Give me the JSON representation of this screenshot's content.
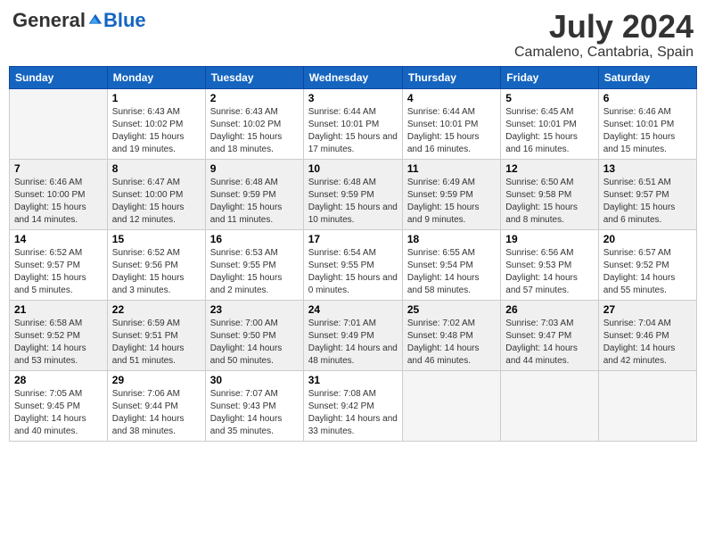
{
  "header": {
    "logo_general": "General",
    "logo_blue": "Blue",
    "month": "July 2024",
    "location": "Camaleno, Cantabria, Spain"
  },
  "weekdays": [
    "Sunday",
    "Monday",
    "Tuesday",
    "Wednesday",
    "Thursday",
    "Friday",
    "Saturday"
  ],
  "weeks": [
    [
      {
        "day": "",
        "empty": true
      },
      {
        "day": "1",
        "sunrise": "Sunrise: 6:43 AM",
        "sunset": "Sunset: 10:02 PM",
        "daylight": "Daylight: 15 hours and 19 minutes."
      },
      {
        "day": "2",
        "sunrise": "Sunrise: 6:43 AM",
        "sunset": "Sunset: 10:02 PM",
        "daylight": "Daylight: 15 hours and 18 minutes."
      },
      {
        "day": "3",
        "sunrise": "Sunrise: 6:44 AM",
        "sunset": "Sunset: 10:01 PM",
        "daylight": "Daylight: 15 hours and 17 minutes."
      },
      {
        "day": "4",
        "sunrise": "Sunrise: 6:44 AM",
        "sunset": "Sunset: 10:01 PM",
        "daylight": "Daylight: 15 hours and 16 minutes."
      },
      {
        "day": "5",
        "sunrise": "Sunrise: 6:45 AM",
        "sunset": "Sunset: 10:01 PM",
        "daylight": "Daylight: 15 hours and 16 minutes."
      },
      {
        "day": "6",
        "sunrise": "Sunrise: 6:46 AM",
        "sunset": "Sunset: 10:01 PM",
        "daylight": "Daylight: 15 hours and 15 minutes."
      }
    ],
    [
      {
        "day": "7",
        "sunrise": "Sunrise: 6:46 AM",
        "sunset": "Sunset: 10:00 PM",
        "daylight": "Daylight: 15 hours and 14 minutes."
      },
      {
        "day": "8",
        "sunrise": "Sunrise: 6:47 AM",
        "sunset": "Sunset: 10:00 PM",
        "daylight": "Daylight: 15 hours and 12 minutes."
      },
      {
        "day": "9",
        "sunrise": "Sunrise: 6:48 AM",
        "sunset": "Sunset: 9:59 PM",
        "daylight": "Daylight: 15 hours and 11 minutes."
      },
      {
        "day": "10",
        "sunrise": "Sunrise: 6:48 AM",
        "sunset": "Sunset: 9:59 PM",
        "daylight": "Daylight: 15 hours and 10 minutes."
      },
      {
        "day": "11",
        "sunrise": "Sunrise: 6:49 AM",
        "sunset": "Sunset: 9:59 PM",
        "daylight": "Daylight: 15 hours and 9 minutes."
      },
      {
        "day": "12",
        "sunrise": "Sunrise: 6:50 AM",
        "sunset": "Sunset: 9:58 PM",
        "daylight": "Daylight: 15 hours and 8 minutes."
      },
      {
        "day": "13",
        "sunrise": "Sunrise: 6:51 AM",
        "sunset": "Sunset: 9:57 PM",
        "daylight": "Daylight: 15 hours and 6 minutes."
      }
    ],
    [
      {
        "day": "14",
        "sunrise": "Sunrise: 6:52 AM",
        "sunset": "Sunset: 9:57 PM",
        "daylight": "Daylight: 15 hours and 5 minutes."
      },
      {
        "day": "15",
        "sunrise": "Sunrise: 6:52 AM",
        "sunset": "Sunset: 9:56 PM",
        "daylight": "Daylight: 15 hours and 3 minutes."
      },
      {
        "day": "16",
        "sunrise": "Sunrise: 6:53 AM",
        "sunset": "Sunset: 9:55 PM",
        "daylight": "Daylight: 15 hours and 2 minutes."
      },
      {
        "day": "17",
        "sunrise": "Sunrise: 6:54 AM",
        "sunset": "Sunset: 9:55 PM",
        "daylight": "Daylight: 15 hours and 0 minutes."
      },
      {
        "day": "18",
        "sunrise": "Sunrise: 6:55 AM",
        "sunset": "Sunset: 9:54 PM",
        "daylight": "Daylight: 14 hours and 58 minutes."
      },
      {
        "day": "19",
        "sunrise": "Sunrise: 6:56 AM",
        "sunset": "Sunset: 9:53 PM",
        "daylight": "Daylight: 14 hours and 57 minutes."
      },
      {
        "day": "20",
        "sunrise": "Sunrise: 6:57 AM",
        "sunset": "Sunset: 9:52 PM",
        "daylight": "Daylight: 14 hours and 55 minutes."
      }
    ],
    [
      {
        "day": "21",
        "sunrise": "Sunrise: 6:58 AM",
        "sunset": "Sunset: 9:52 PM",
        "daylight": "Daylight: 14 hours and 53 minutes."
      },
      {
        "day": "22",
        "sunrise": "Sunrise: 6:59 AM",
        "sunset": "Sunset: 9:51 PM",
        "daylight": "Daylight: 14 hours and 51 minutes."
      },
      {
        "day": "23",
        "sunrise": "Sunrise: 7:00 AM",
        "sunset": "Sunset: 9:50 PM",
        "daylight": "Daylight: 14 hours and 50 minutes."
      },
      {
        "day": "24",
        "sunrise": "Sunrise: 7:01 AM",
        "sunset": "Sunset: 9:49 PM",
        "daylight": "Daylight: 14 hours and 48 minutes."
      },
      {
        "day": "25",
        "sunrise": "Sunrise: 7:02 AM",
        "sunset": "Sunset: 9:48 PM",
        "daylight": "Daylight: 14 hours and 46 minutes."
      },
      {
        "day": "26",
        "sunrise": "Sunrise: 7:03 AM",
        "sunset": "Sunset: 9:47 PM",
        "daylight": "Daylight: 14 hours and 44 minutes."
      },
      {
        "day": "27",
        "sunrise": "Sunrise: 7:04 AM",
        "sunset": "Sunset: 9:46 PM",
        "daylight": "Daylight: 14 hours and 42 minutes."
      }
    ],
    [
      {
        "day": "28",
        "sunrise": "Sunrise: 7:05 AM",
        "sunset": "Sunset: 9:45 PM",
        "daylight": "Daylight: 14 hours and 40 minutes."
      },
      {
        "day": "29",
        "sunrise": "Sunrise: 7:06 AM",
        "sunset": "Sunset: 9:44 PM",
        "daylight": "Daylight: 14 hours and 38 minutes."
      },
      {
        "day": "30",
        "sunrise": "Sunrise: 7:07 AM",
        "sunset": "Sunset: 9:43 PM",
        "daylight": "Daylight: 14 hours and 35 minutes."
      },
      {
        "day": "31",
        "sunrise": "Sunrise: 7:08 AM",
        "sunset": "Sunset: 9:42 PM",
        "daylight": "Daylight: 14 hours and 33 minutes."
      },
      {
        "day": "",
        "empty": true
      },
      {
        "day": "",
        "empty": true
      },
      {
        "day": "",
        "empty": true
      }
    ]
  ]
}
